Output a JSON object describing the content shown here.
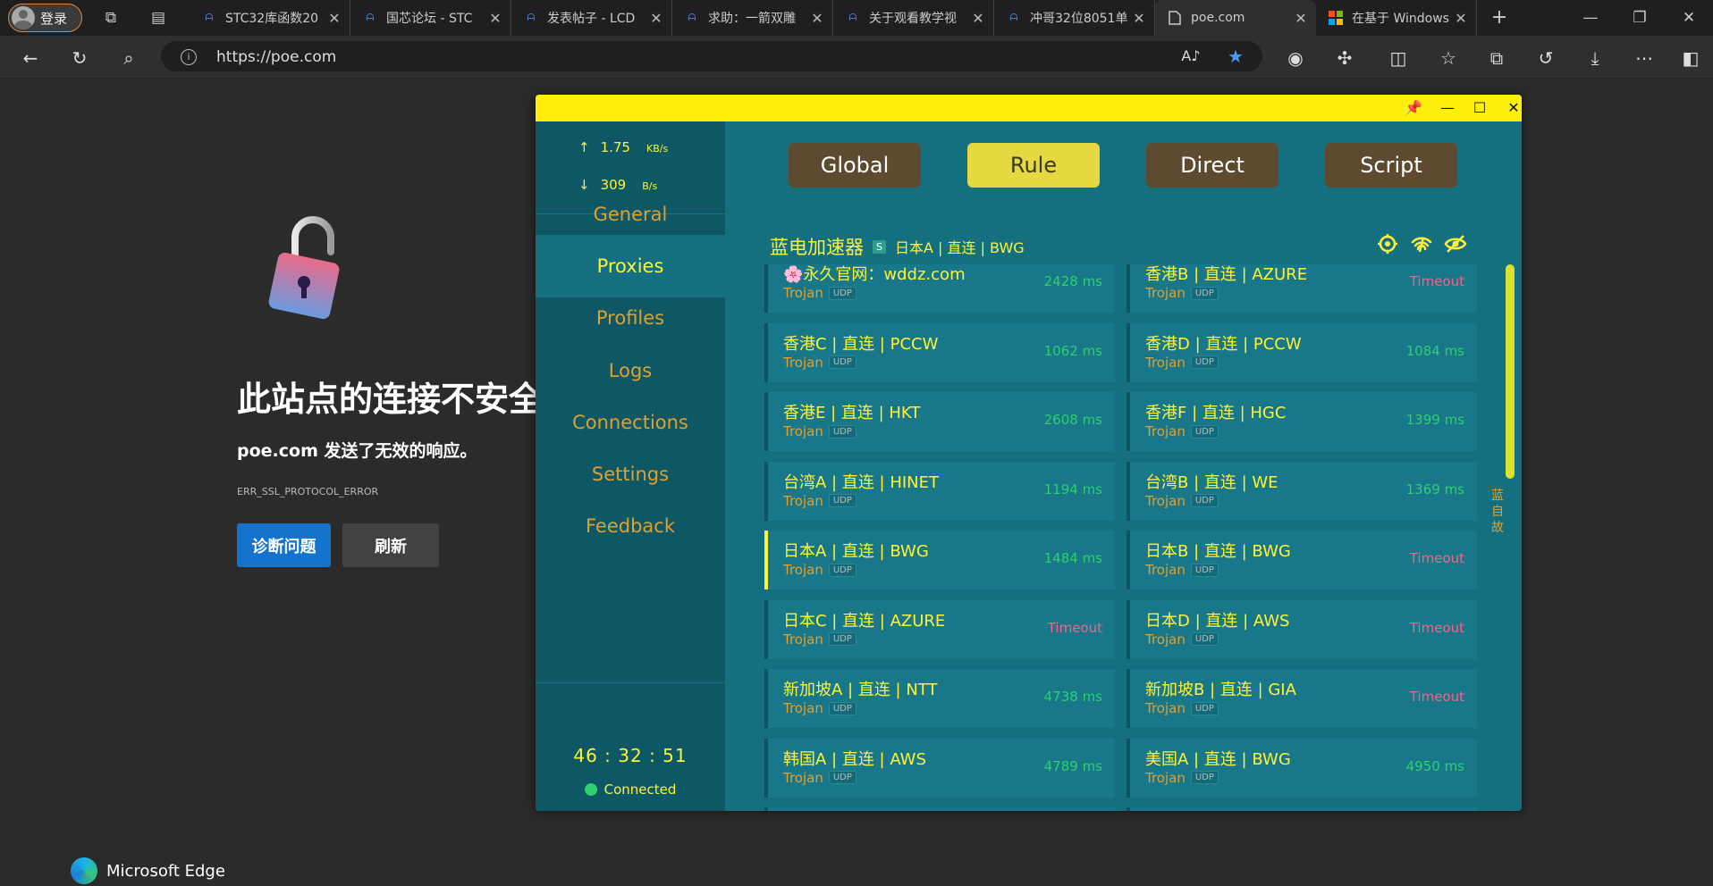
{
  "browser": {
    "login_label": "登录",
    "tabs": [
      {
        "title": "STC32库函数20",
        "favicon": "stc-icon"
      },
      {
        "title": "国芯论坛 - STC",
        "favicon": "stc-icon"
      },
      {
        "title": "发表帖子 - LCD",
        "favicon": "stc-icon"
      },
      {
        "title": "求助：一箭双雕",
        "favicon": "stc-icon"
      },
      {
        "title": "关于观看教学视",
        "favicon": "stc-icon"
      },
      {
        "title": "冲哥32位8051单",
        "favicon": "stc-icon"
      },
      {
        "title": "poe.com",
        "favicon": "page-icon",
        "active": true
      },
      {
        "title": "在基于 Windows",
        "favicon": "windows-icon"
      }
    ],
    "url": "https://poe.com"
  },
  "error_page": {
    "title": "此站点的连接不安全",
    "subtitle": "poe.com 发送了无效的响应。",
    "code": "ERR_SSL_PROTOCOL_ERROR",
    "diagnose_label": "诊断问题",
    "refresh_label": "刷新",
    "brand": "Microsoft Edge"
  },
  "clash": {
    "traffic": {
      "up_value": "1.75",
      "up_unit": "KB/s",
      "up_arrow": "↑",
      "down_value": "309",
      "down_unit": "B/s",
      "down_arrow": "↓"
    },
    "nav": [
      "General",
      "Proxies",
      "Profiles",
      "Logs",
      "Connections",
      "Settings",
      "Feedback"
    ],
    "active_nav": "Proxies",
    "timer": "46 : 32 : 51",
    "status": "Connected",
    "modes": [
      "Global",
      "Rule",
      "Direct",
      "Script"
    ],
    "active_mode": "Rule",
    "group": {
      "name": "蓝电加速器",
      "badge": "S",
      "selected": "日本A | 直连 | BWG"
    },
    "vertical_label": "蓝自故",
    "proxies": [
      {
        "name": "🌸永久官网：wddz.com",
        "type": "Trojan",
        "udp": "UDP",
        "delay": "2428 ms"
      },
      {
        "name": "香港B | 直连 | AZURE",
        "type": "Trojan",
        "udp": "UDP",
        "delay": "Timeout"
      },
      {
        "name": "香港C | 直连 | PCCW",
        "type": "Trojan",
        "udp": "UDP",
        "delay": "1062 ms"
      },
      {
        "name": "香港D | 直连 | PCCW",
        "type": "Trojan",
        "udp": "UDP",
        "delay": "1084 ms"
      },
      {
        "name": "香港E | 直连 | HKT",
        "type": "Trojan",
        "udp": "UDP",
        "delay": "2608 ms"
      },
      {
        "name": "香港F | 直连 | HGC",
        "type": "Trojan",
        "udp": "UDP",
        "delay": "1399 ms"
      },
      {
        "name": "台湾A | 直连 | HINET",
        "type": "Trojan",
        "udp": "UDP",
        "delay": "1194 ms"
      },
      {
        "name": "台湾B | 直连 | WE",
        "type": "Trojan",
        "udp": "UDP",
        "delay": "1369 ms"
      },
      {
        "name": "日本A | 直连 | BWG",
        "type": "Trojan",
        "udp": "UDP",
        "delay": "1484 ms",
        "selected": true
      },
      {
        "name": "日本B | 直连 | BWG",
        "type": "Trojan",
        "udp": "UDP",
        "delay": "Timeout"
      },
      {
        "name": "日本C | 直连 | AZURE",
        "type": "Trojan",
        "udp": "UDP",
        "delay": "Timeout"
      },
      {
        "name": "日本D | 直连 | AWS",
        "type": "Trojan",
        "udp": "UDP",
        "delay": "Timeout"
      },
      {
        "name": "新加坡A | 直连 | NTT",
        "type": "Trojan",
        "udp": "UDP",
        "delay": "4738 ms"
      },
      {
        "name": "新加坡B | 直连 | GIA",
        "type": "Trojan",
        "udp": "UDP",
        "delay": "Timeout"
      },
      {
        "name": "韩国A | 直连 | AWS",
        "type": "Trojan",
        "udp": "UDP",
        "delay": "4789 ms"
      },
      {
        "name": "美国A | 直连 | BWG",
        "type": "Trojan",
        "udp": "UDP",
        "delay": "4950 ms"
      }
    ]
  },
  "colors": {
    "titlebar": "#fff00b",
    "accent_yellow": "#fff33a",
    "nav_orange": "#e0a030",
    "ok_green": "#2ed06f",
    "timeout_pink": "#f0668a"
  }
}
